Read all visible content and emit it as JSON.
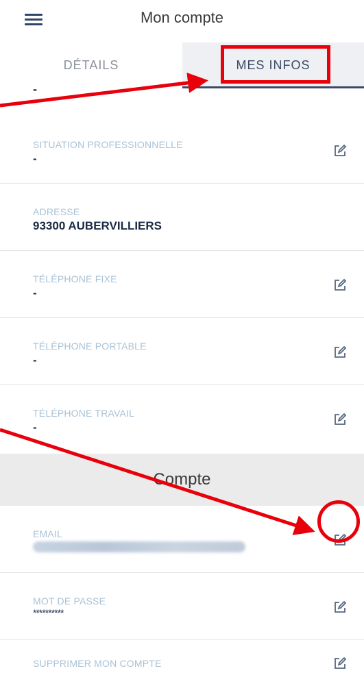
{
  "header": {
    "title": "Mon compte",
    "menu_icon": "hamburger-icon"
  },
  "tabs": [
    {
      "label": "DÉTAILS",
      "active": false
    },
    {
      "label": "MES INFOS",
      "active": true
    }
  ],
  "top_value": "-",
  "rows": [
    {
      "label": "SITUATION PROFESSIONNELLE",
      "value": "-",
      "editable": true
    },
    {
      "label": "ADRESSE",
      "value": "93300 AUBERVILLIERS",
      "editable": false
    },
    {
      "label": "TÉLÉPHONE FIXE",
      "value": "-",
      "editable": true
    },
    {
      "label": "TÉLÉPHONE PORTABLE",
      "value": "-",
      "editable": true
    },
    {
      "label": "TÉLÉPHONE TRAVAIL",
      "value": "-",
      "editable": true
    }
  ],
  "section": {
    "title": "Compte"
  },
  "account_rows": [
    {
      "label": "EMAIL",
      "value": "",
      "editable": true
    },
    {
      "label": "MOT DE PASSE",
      "value": "**********",
      "editable": true
    },
    {
      "label": "SUPPRIMER MON COMPTE",
      "value": "",
      "editable": true
    }
  ],
  "colors": {
    "accent": "#3a4a66",
    "label": "#a9c2d6",
    "annotation": "#e8000b",
    "section_bg": "#ebebeb"
  },
  "icons": {
    "edit": "edit-icon"
  }
}
